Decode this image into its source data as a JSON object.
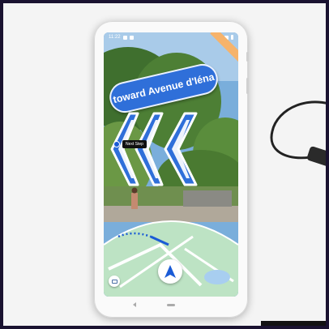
{
  "status_bar": {
    "time": "11:22"
  },
  "ar_view": {
    "direction_label": "toward Avenue d'Iéna",
    "next_step_label": "Next Step"
  },
  "colors": {
    "accent_blue": "#2f6fd9",
    "map_green": "#bde3c4",
    "sky": "#7aaedb"
  },
  "icons": {
    "chat": "chat-bubble-icon",
    "navigation": "navigation-arrow-icon"
  }
}
